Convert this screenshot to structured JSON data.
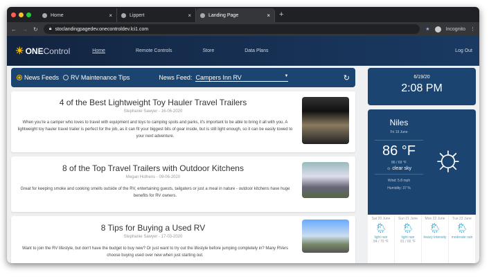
{
  "browser": {
    "tabs": [
      {
        "label": "Home"
      },
      {
        "label": "Lippert"
      },
      {
        "label": "Landing Page"
      }
    ],
    "url": "stoclandingpagedev.onecontroldev.lci1.com",
    "profile": "Incognito"
  },
  "nav": {
    "logo_one": "ONE",
    "logo_control": "Control",
    "items": [
      "Home",
      "Remote Controls",
      "Store",
      "Data Plans"
    ],
    "logout": "Log Out"
  },
  "feedbar": {
    "option1": "News Feeds",
    "option2": "RV Maintenance Tips",
    "feed_label": "News Feed:",
    "feed_value": "Campers Inn RV"
  },
  "articles": [
    {
      "title": "4 of the Best Lightweight Toy Hauler Travel Trailers",
      "meta": "Stephanie Sawyer - 16-06-2020",
      "desc": "When you're a camper who loves to travel with equipment and toys to camping spots and parks, it's important to be able to bring it all with you. A lightweight toy hauler travel trailer is perfect for the job, as it can fit your biggest bits of gear inside, but is still light enough, so it can be easily towed to your next adventure."
    },
    {
      "title": "8 of the Top Travel Trailers with Outdoor Kitchens",
      "meta": "Megan Hothens - 09-06-2020",
      "desc": "Great for keeping smoke and cooking smells outside of the RV, entertaining guests, tailgaters or just a meal in nature - outdoor kitchens have huge benefits for RV owners."
    },
    {
      "title": "8 Tips for Buying a Used RV",
      "meta": "Stephanie Sawyer - 17-03-2020",
      "desc": "Want to join the RV lifestyle, but don't have the budget to buy new? Or just want to try out the lifestyle before jumping completely in? Many RVers choose buying used over new when just starting out."
    }
  ],
  "clock": {
    "date": "6/19/20",
    "time": "2:08 PM"
  },
  "weather": {
    "city": "Niles",
    "date": "Fri 19 June",
    "temp": "86 °F",
    "range": "86 / 69 °F",
    "condition": "clear sky",
    "wind": "Wind: 5.8 mph",
    "humidity": "Humidity: 37 %"
  },
  "forecast": [
    {
      "day": "Sat 20 June",
      "desc": "light rain",
      "range": "84 / 70 °F"
    },
    {
      "day": "Sun 21 June",
      "desc": "light rain",
      "range": "81 / 66 °F"
    },
    {
      "day": "Mon 22 June",
      "desc": "heavy intensity",
      "range": ""
    },
    {
      "day": "Tue 23 June",
      "desc": "moderate rain",
      "range": ""
    }
  ]
}
